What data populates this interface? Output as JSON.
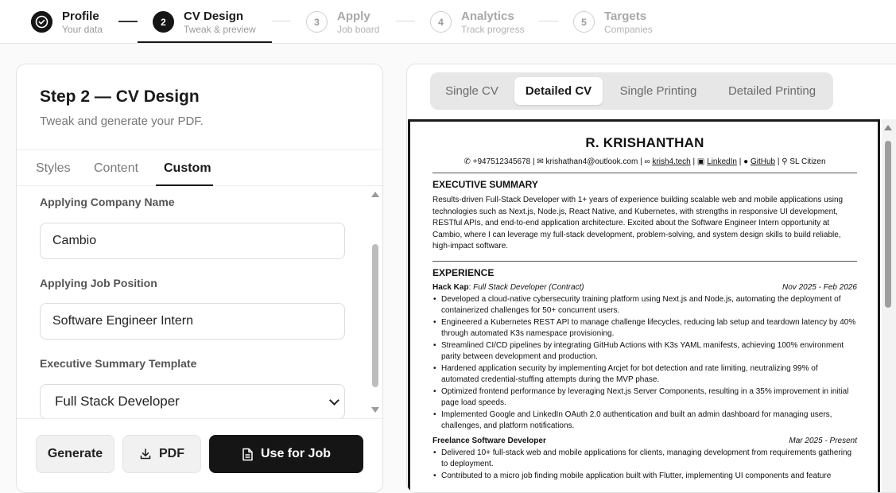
{
  "stepper": {
    "steps": [
      {
        "number": "",
        "title": "Profile",
        "subtitle": "Your data",
        "state": "done"
      },
      {
        "number": "2",
        "title": "CV Design",
        "subtitle": "Tweak & preview",
        "state": "active"
      },
      {
        "number": "3",
        "title": "Apply",
        "subtitle": "Job board",
        "state": "todo"
      },
      {
        "number": "4",
        "title": "Analytics",
        "subtitle": "Track progress",
        "state": "todo"
      },
      {
        "number": "5",
        "title": "Targets",
        "subtitle": "Companies",
        "state": "todo"
      }
    ]
  },
  "left_panel": {
    "title": "Step 2 — CV Design",
    "subtitle": "Tweak and generate your PDF.",
    "tabs": [
      "Styles",
      "Content",
      "Custom"
    ],
    "active_tab": "Custom",
    "fields": {
      "company_label": "Applying Company Name",
      "company_value": "Cambio",
      "position_label": "Applying Job Position",
      "position_value": "Software Engineer Intern",
      "summary_label": "Executive Summary Template",
      "summary_value": "Full Stack Developer"
    },
    "buttons": {
      "generate": "Generate",
      "pdf": "PDF",
      "use_for_job": "Use for Job"
    }
  },
  "right_panel": {
    "tabs": [
      "Single CV",
      "Detailed CV",
      "Single Printing",
      "Detailed Printing"
    ],
    "active_tab": "Detailed CV"
  },
  "cv": {
    "name": "R. KRISHANTHAN",
    "contact": {
      "phone": "+947512345678",
      "email": "krishathan4@outlook.com",
      "website": "krish4.tech",
      "linkedin": "LinkedIn",
      "github": "GitHub",
      "citizenship": "SL Citizen"
    },
    "summary_heading": "EXECUTIVE SUMMARY",
    "summary_text": "Results-driven Full-Stack Developer with 1+ years of experience building scalable web and mobile applications using technologies such as Next.js, Node.js, React Native, and Kubernetes, with strengths in responsive UI development, RESTful APIs, and end-to-end application architecture. Excited about the Software Engineer Intern opportunity at Cambio, where I can leverage my full-stack development, problem-solving, and system design skills to build reliable, high-impact software.",
    "experience_heading": "EXPERIENCE",
    "jobs": [
      {
        "company": "Hack Kap",
        "role": "Full Stack Developer (Contract)",
        "dates": "Nov 2025 - Feb 2026",
        "bullets": [
          "Developed a cloud-native cybersecurity training platform using Next.js and Node.js, automating the deployment of containerized challenges for 50+ concurrent users.",
          "Engineered a Kubernetes REST API to manage challenge lifecycles, reducing lab setup and teardown latency by 40% through automated K3s namespace provisioning.",
          "Streamlined CI/CD pipelines by integrating GitHub Actions with K3s YAML manifests, achieving 100% environment parity between development and production.",
          "Hardened application security by implementing Arcjet for bot detection and rate limiting, neutralizing 99% of automated credential-stuffing attempts during the MVP phase.",
          "Optimized frontend performance by leveraging Next.js Server Components, resulting in a 35% improvement in initial page load speeds.",
          "Implemented Google and LinkedIn OAuth 2.0 authentication and built an admin dashboard for managing users, challenges, and platform notifications."
        ]
      },
      {
        "company": "Freelance Software Developer",
        "role": "",
        "dates": "Mar 2025 - Present",
        "bullets": [
          "Delivered 10+ full-stack web and mobile applications for clients, managing development from requirements gathering to deployment.",
          "Contributed to a micro job finding mobile application built with Flutter, implementing UI components and feature"
        ]
      }
    ]
  }
}
